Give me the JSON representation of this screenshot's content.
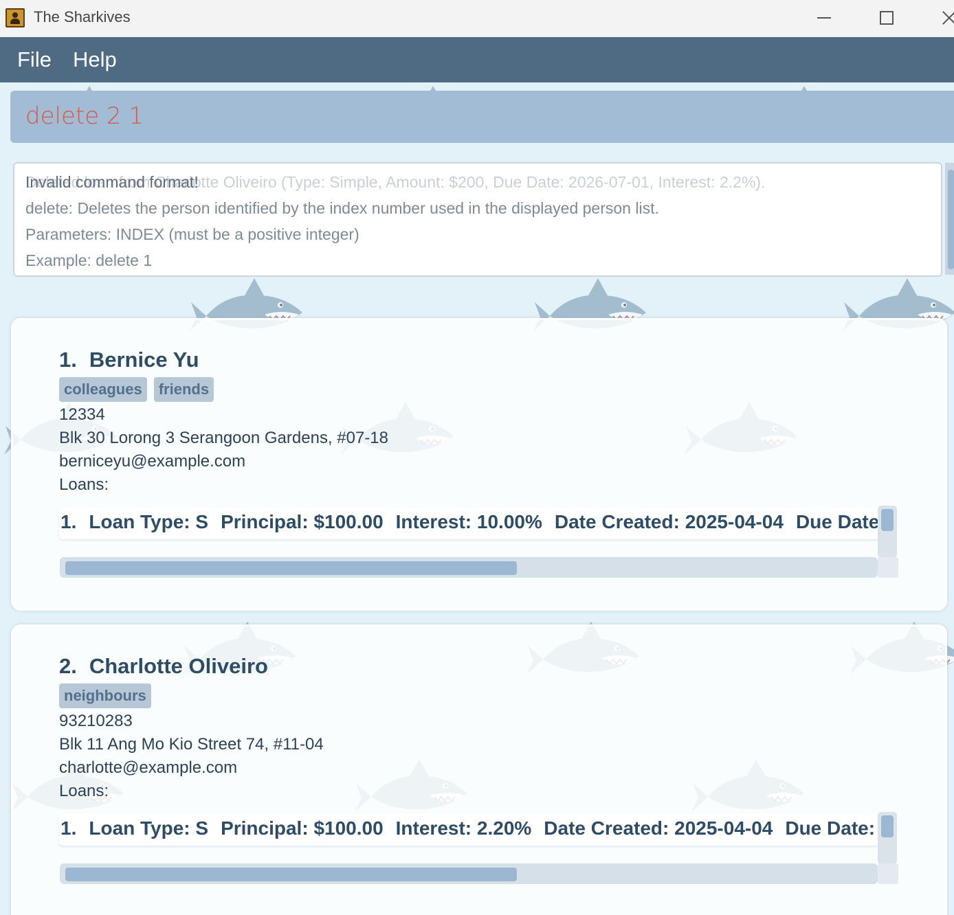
{
  "window": {
    "title": "The Sharkives"
  },
  "menu": {
    "file": "File",
    "help": "Help"
  },
  "command": {
    "text": "delete 2 1",
    "color": "#d35a48"
  },
  "result": {
    "ghost_text": "Deleted loan from Charlotte Oliveiro (Type: Simple, Amount: $200, Due Date: 2026-07-01, Interest: 2.2%).",
    "lines": [
      "Invalid command format!",
      "delete: Deletes the person identified by the index number used in the displayed person list.",
      "Parameters: INDEX (must be a positive integer)",
      "Example: delete 1"
    ]
  },
  "persons": [
    {
      "index": "1.",
      "name": "Bernice Yu",
      "tags": [
        "colleagues",
        "friends"
      ],
      "phone": "12334",
      "address": "Blk 30 Lorong 3 Serangoon Gardens, #07-18",
      "email": "berniceyu@example.com",
      "loans_label": "Loans:",
      "loan": {
        "index": "1.",
        "type": "Loan Type: S",
        "principal": "Principal: $100.00",
        "interest": "Interest: 10.00%",
        "date_created": "Date Created: 2025-04-04",
        "due_date": "Due Date:"
      },
      "h_scroll_fraction": 0.56
    },
    {
      "index": "2.",
      "name": "Charlotte Oliveiro",
      "tags": [
        "neighbours"
      ],
      "phone": "93210283",
      "address": "Blk 11 Ang Mo Kio Street 74, #11-04",
      "email": "charlotte@example.com",
      "loans_label": "Loans:",
      "loan": {
        "index": "1.",
        "type": "Loan Type: S",
        "principal": "Principal: $100.00",
        "interest": "Interest: 2.20%",
        "date_created": "Date Created: 2025-04-04",
        "due_date": "Due Date:"
      },
      "h_scroll_fraction": 0.56
    }
  ],
  "colors": {
    "menubar": "#4f6b83",
    "command_bar": "#a1bcd4",
    "accent_dark": "#2f4c66",
    "tag_bg": "#b7c7d6"
  }
}
